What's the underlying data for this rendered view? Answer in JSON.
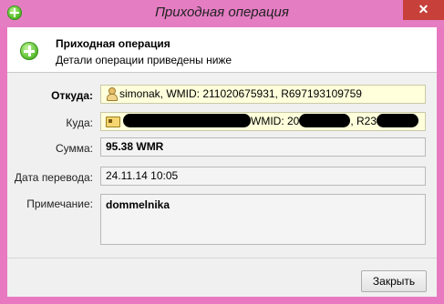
{
  "window": {
    "title": "Приходная операция",
    "close_glyph": "✕",
    "close_color": "#c7403a"
  },
  "header": {
    "title": "Приходная операция",
    "subtitle": "Детали операции приведены ниже",
    "icon": "plus-circle-icon"
  },
  "fields": {
    "from": {
      "label": "Откуда:",
      "value": "simonak, WMID: 211020675931, R697193109759",
      "icon": "person-icon"
    },
    "to": {
      "label": "Куда:",
      "wmid_label": "WMID: 20",
      "purse_prefix": ", R23",
      "icon": "card-icon"
    },
    "amount": {
      "label": "Сумма:",
      "value": "95.38 WMR"
    },
    "date": {
      "label": "Дата перевода:",
      "value": "24.11.14 10:05"
    },
    "note": {
      "label": "Примечание:",
      "value": "dommelnika"
    }
  },
  "buttons": {
    "close": "Закрыть"
  }
}
